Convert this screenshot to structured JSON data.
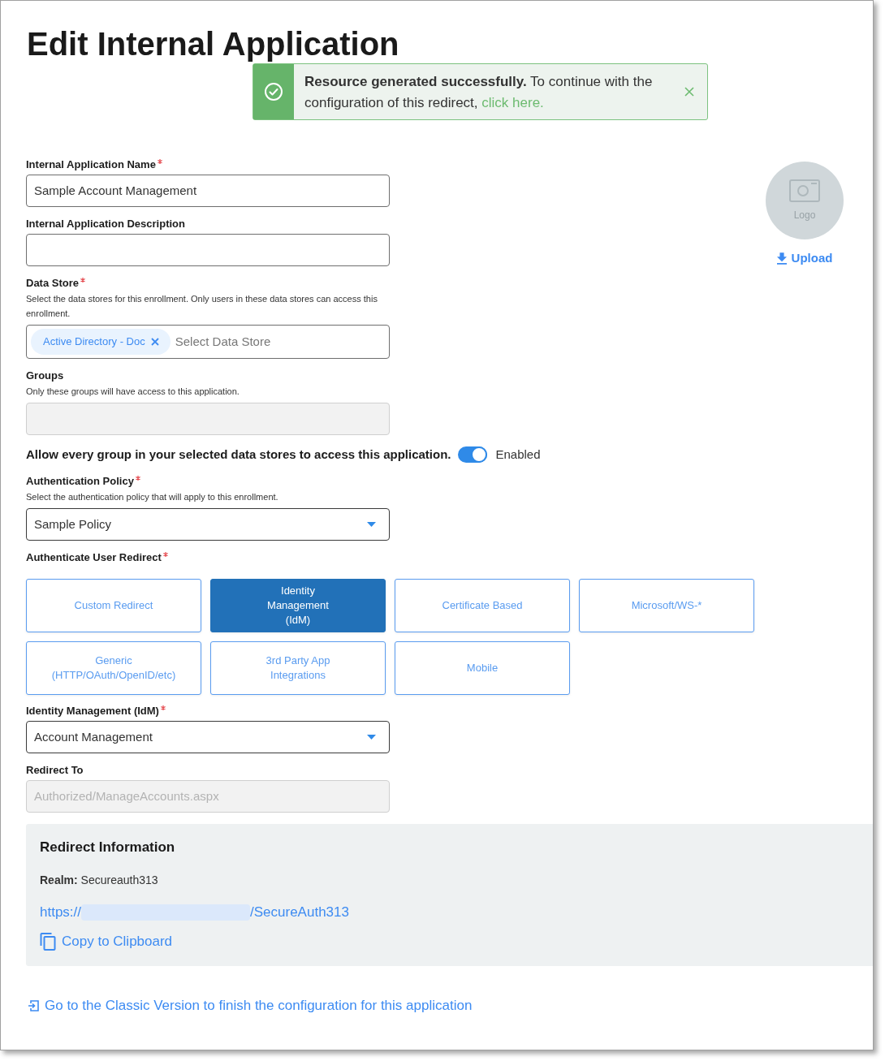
{
  "page": {
    "title": "Edit Internal Application"
  },
  "toast": {
    "kind": "success",
    "message": "**Resource generated successfully.** To continue with the configuration of this redirect,",
    "link": "click here."
  },
  "logo": {
    "label": "Logo",
    "upload": "Upload"
  },
  "fields": [
    {
      "kind": "text",
      "label": "Internal Application Name",
      "required": true,
      "disabled": false,
      "value": "Sample Account Management"
    },
    {
      "kind": "text",
      "label": "Internal Application Description",
      "required": false,
      "disabled": false
    },
    {
      "kind": "tags",
      "label": "Data Store",
      "required": true,
      "hint": "Select the data stores for this enrollment. Only users in these data stores can access this enrollment.",
      "tags": [
        "Active Directory - Doc"
      ],
      "placeholder": "Select Data Store"
    },
    {
      "kind": "text",
      "label": "Groups",
      "required": false,
      "disabled": true,
      "hint": "Only these groups will have access to this application."
    },
    {
      "kind": "toggle",
      "label": "Allow every group in your selected data stores to access this application.",
      "on": true,
      "state_label": "Enabled"
    },
    {
      "kind": "select",
      "label": "Authentication Policy",
      "required": true,
      "hint": "Select the authentication policy that will apply to this enrollment.",
      "value": "Sample Policy"
    },
    {
      "kind": "tiles",
      "label": "Authenticate User Redirect",
      "required": true,
      "options": [
        {
          "label": "Custom Redirect",
          "selected": false
        },
        {
          "label": "Identity Management (IdM)",
          "selected": true
        },
        {
          "label": "Certificate Based",
          "selected": false
        },
        {
          "label": "Microsoft/WS-*",
          "selected": false
        },
        {
          "label": "Generic (HTTP/OAuth/OpenID/etc)",
          "selected": false
        },
        {
          "label": "3rd Party App Integrations",
          "selected": false
        },
        {
          "label": "Mobile",
          "selected": false
        }
      ]
    },
    {
      "kind": "select",
      "label": "Identity Management (IdM)",
      "required": true,
      "value": "Account Management"
    },
    {
      "kind": "text",
      "label": "Redirect To",
      "required": false,
      "disabled": true,
      "value": "Authorized/ManageAccounts.aspx"
    }
  ],
  "redirect_info": {
    "title": "Redirect Information",
    "realm": "**Realm:** Secureauth313",
    "url_prefix": "https://",
    "url_suffix": "/SecureAuth313",
    "copy": "Copy to Clipboard"
  },
  "footer_link": "Go to the Classic Version to finish the configuration for this application"
}
